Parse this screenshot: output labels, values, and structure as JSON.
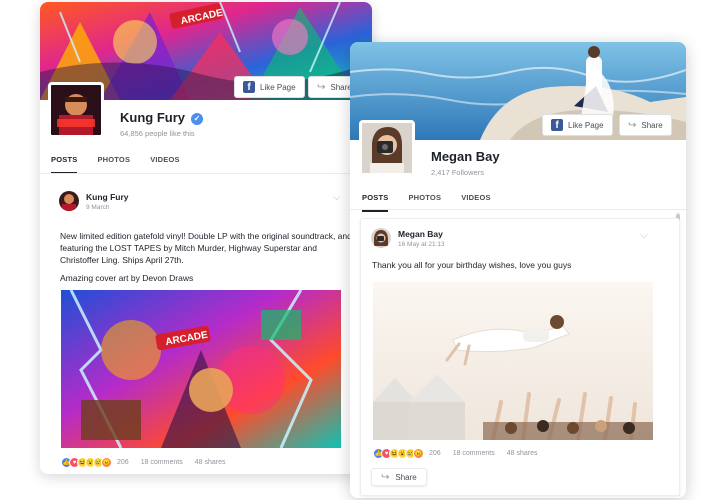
{
  "kungfury": {
    "buttons": {
      "like_page": "Like Page",
      "share": "Share"
    },
    "page_name": "Kung Fury",
    "likes": "64,856 people like this",
    "tabs": [
      "POSTS",
      "PHOTOS",
      "VIDEOS"
    ],
    "post": {
      "author": "Kung Fury",
      "date": "9 March",
      "text1": "New limited edition gatefold vinyl! Double LP with the original soundtrack, and featuring the LOST TAPES by Mitch Murder, Highway Superstar and Christoffer Ling. Ships April 27th.",
      "text2": "Amazing cover art by Devon Draws",
      "arcade_sign": "ARCADE",
      "reactions_count": "206",
      "comments": "18 comments",
      "shares": "48 shares"
    }
  },
  "meganbay": {
    "buttons": {
      "like_page": "Like Page",
      "share": "Share"
    },
    "page_name": "Megan Bay",
    "followers": "2,417 Followers",
    "tabs": [
      "POSTS",
      "PHOTOS",
      "VIDEOS"
    ],
    "post": {
      "author": "Megan Bay",
      "date": "16 May at 21:13",
      "text": "Thank you all for your birthday wishes, love you guys",
      "reactions_count": "206",
      "comments": "18 comments",
      "shares": "48 shares",
      "share_button": "Share"
    }
  },
  "colors": {
    "facebook_blue": "#3b5998",
    "like_blue": "#4a7fec",
    "love_red": "#f25268",
    "verified_blue": "#4a8ff0"
  },
  "icons": [
    "facebook-icon",
    "share-arrow-icon",
    "verified-badge-icon",
    "chevron-down-icon",
    "like-reaction-icon",
    "love-reaction-icon",
    "haha-reaction-icon",
    "wow-reaction-icon",
    "sad-reaction-icon",
    "angry-reaction-icon"
  ]
}
